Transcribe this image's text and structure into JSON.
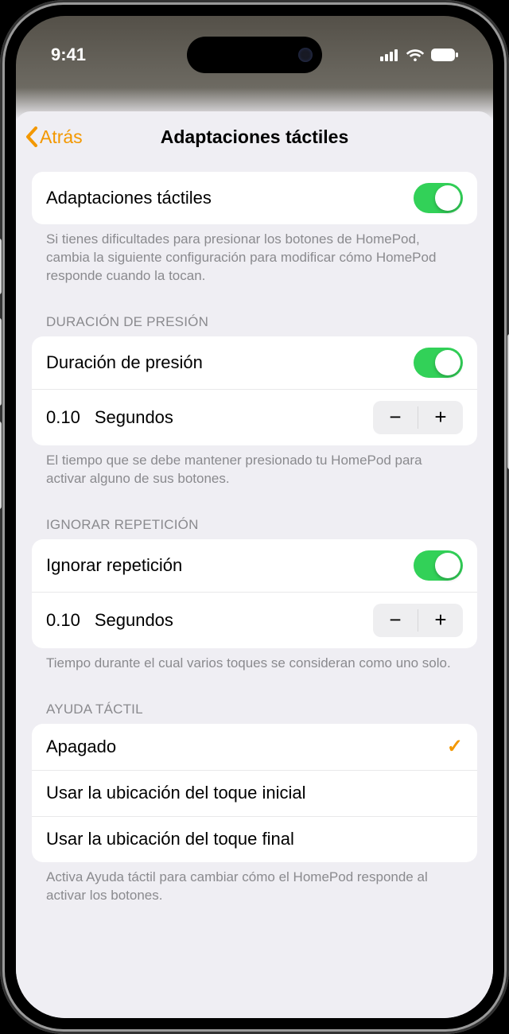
{
  "status": {
    "time": "9:41"
  },
  "nav": {
    "back_label": "Atrás",
    "title": "Adaptaciones táctiles"
  },
  "main_toggle": {
    "label": "Adaptaciones táctiles",
    "on": true,
    "footer": "Si tienes dificultades para presionar los botones de HomePod, cambia la siguiente configuración para modificar cómo HomePod responde cuando la tocan."
  },
  "hold_duration": {
    "header": "DURACIÓN DE PRESIÓN",
    "label": "Duración de presión",
    "on": true,
    "value": "0.10",
    "unit": "Segundos",
    "footer": "El tiempo que se debe mantener presionado tu HomePod para activar alguno de sus botones."
  },
  "ignore_repeat": {
    "header": "IGNORAR REPETICIÓN",
    "label": "Ignorar repetición",
    "on": true,
    "value": "0.10",
    "unit": "Segundos",
    "footer": "Tiempo durante el cual varios toques se consideran como uno solo."
  },
  "tap_assist": {
    "header": "AYUDA TÁCTIL",
    "options": [
      {
        "label": "Apagado",
        "selected": true
      },
      {
        "label": "Usar la ubicación del toque inicial",
        "selected": false
      },
      {
        "label": "Usar la ubicación del toque final",
        "selected": false
      }
    ],
    "footer": "Activa Ayuda táctil para cambiar cómo el HomePod responde al activar los botones."
  },
  "colors": {
    "accent": "#f39800",
    "switch_on": "#32d158"
  }
}
